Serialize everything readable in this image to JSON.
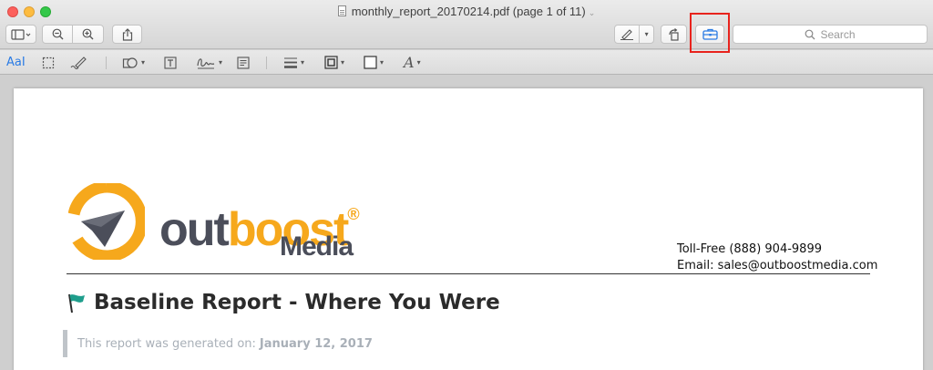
{
  "window": {
    "title": "monthly_report_20170214.pdf (page 1 of 11)"
  },
  "toolbar": {
    "search_placeholder": "Search",
    "icons": [
      "sidebar-icon",
      "zoom-out-icon",
      "zoom-in-icon",
      "share-icon",
      "pen-icon",
      "rotate-icon",
      "toolbox-icon",
      "search-icon"
    ]
  },
  "markup_toolbar": {
    "text_selection_label": "AaI",
    "icons": [
      "rect-selection-icon",
      "sketch-icon",
      "shapes-icon",
      "text-box-icon",
      "signature-icon",
      "note-icon",
      "line-style-icon",
      "border-color-icon",
      "fill-color-icon",
      "text-style-icon"
    ]
  },
  "document": {
    "logo": {
      "word_out": "out",
      "word_boost": "boost",
      "registered": "®",
      "word_media": "Media",
      "colors": {
        "orange": "#f6a81c",
        "gray": "#4b4e5a"
      }
    },
    "contact": {
      "phone": "Toll-Free (888) 904-9899",
      "email": "Email: sales@outboostmedia.com"
    },
    "heading": "Baseline Report - Where You Were",
    "generated_prefix": "This report was generated on:",
    "generated_date": "January 12, 2017"
  },
  "colors": {
    "highlight": "#e8231d",
    "accent_blue": "#2a7be4",
    "flag_teal": "#1f9e8c"
  }
}
